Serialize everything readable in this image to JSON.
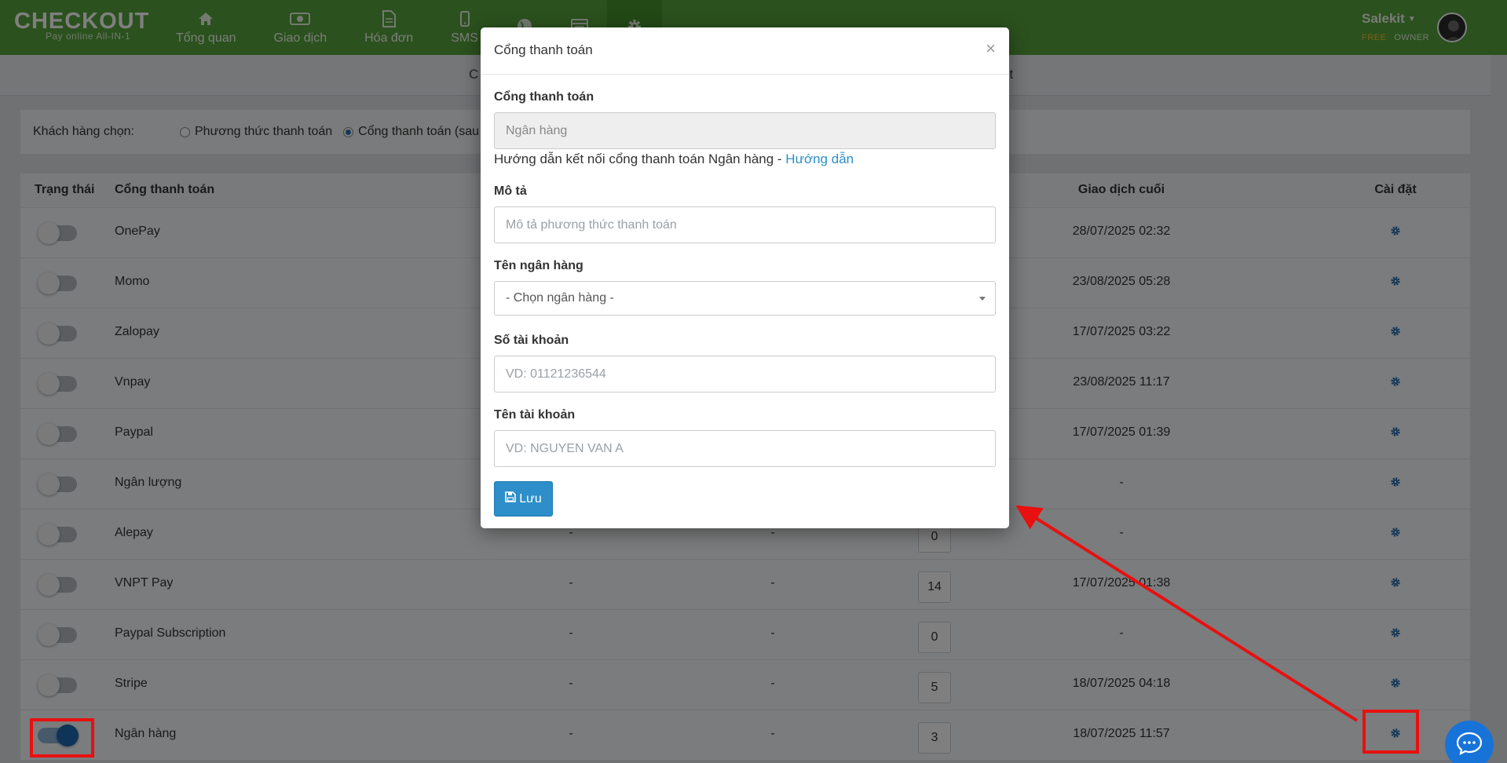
{
  "logo": {
    "main": "CHECKOUT",
    "sub": "Pay online All-IN-1"
  },
  "nav": {
    "items": [
      {
        "label": "Tổng quan",
        "icon": "home-icon"
      },
      {
        "label": "Giao dịch",
        "icon": "money-icon"
      },
      {
        "label": "Hóa đơn",
        "icon": "file-icon"
      },
      {
        "label": "SMS",
        "icon": "mobile-icon"
      },
      {
        "label": "",
        "icon": "globe-icon"
      },
      {
        "label": "",
        "icon": "calendar-icon"
      },
      {
        "label": "",
        "icon": "gear-icon"
      }
    ]
  },
  "user": {
    "name": "Salekit",
    "plan": "FREE",
    "role": "OWNER"
  },
  "subnav": {
    "left": "C",
    "right": "ct"
  },
  "choose": {
    "label": "Khách hàng chọn:",
    "option1": "Phương thức thanh toán",
    "option2": "Cổng thanh toán (sau đó"
  },
  "table": {
    "headers": {
      "status": "Trạng thái",
      "gateway": "Cổng thanh toán",
      "last": "Giao dịch cuối",
      "settings": "Cài đặt"
    },
    "rows": [
      {
        "name": "OnePay",
        "c1": "",
        "c2": "",
        "count": "",
        "last": "28/07/2025 02:32",
        "on": false
      },
      {
        "name": "Momo",
        "c1": "",
        "c2": "",
        "count": "",
        "last": "23/08/2025 05:28",
        "on": false
      },
      {
        "name": "Zalopay",
        "c1": "",
        "c2": "",
        "count": "",
        "last": "17/07/2025 03:22",
        "on": false
      },
      {
        "name": "Vnpay",
        "c1": "",
        "c2": "",
        "count": "",
        "last": "23/08/2025 11:17",
        "on": false
      },
      {
        "name": "Paypal",
        "c1": "",
        "c2": "",
        "count": "",
        "last": "17/07/2025 01:39",
        "on": false
      },
      {
        "name": "Ngân lượng",
        "c1": "",
        "c2": "",
        "count": "",
        "last": "-",
        "on": false
      },
      {
        "name": "Alepay",
        "c1": "-",
        "c2": "-",
        "count": "0",
        "last": "-",
        "on": false
      },
      {
        "name": "VNPT Pay",
        "c1": "-",
        "c2": "-",
        "count": "14",
        "last": "17/07/2025 01:38",
        "on": false
      },
      {
        "name": "Paypal Subscription",
        "c1": "-",
        "c2": "-",
        "count": "0",
        "last": "-",
        "on": false
      },
      {
        "name": "Stripe",
        "c1": "-",
        "c2": "-",
        "count": "5",
        "last": "18/07/2025 04:18",
        "on": false
      },
      {
        "name": "Ngân hàng",
        "c1": "-",
        "c2": "-",
        "count": "3",
        "last": "18/07/2025 11:57",
        "on": true
      }
    ]
  },
  "modal": {
    "title": "Cổng thanh toán",
    "gateway_label": "Cổng thanh toán",
    "gateway_value": "Ngân hàng",
    "help_text": "Hướng dẫn kết nối cổng thanh toán Ngân hàng - ",
    "help_link": "Hướng dẫn",
    "desc_label": "Mô tả",
    "desc_placeholder": "Mô tả phương thức thanh toán",
    "bank_label": "Tên ngân hàng",
    "bank_select": "- Chọn ngân hàng -",
    "account_no_label": "Số tài khoản",
    "account_no_placeholder": "VD: 01121236544",
    "account_name_label": "Tên tài khoản",
    "account_name_placeholder": "VD: NGUYEN VAN A",
    "save_label": "Lưu",
    "close": "×"
  },
  "colors": {
    "topbar": "#56a33d",
    "accent": "#2d8ec9",
    "annotation": "#e81010",
    "toggle_on": "#1f69b3"
  }
}
